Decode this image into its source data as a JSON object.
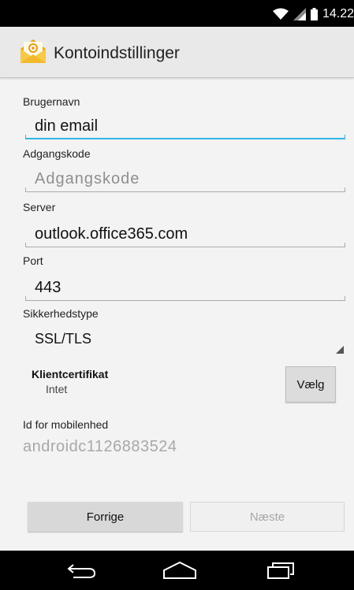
{
  "status_bar": {
    "time": "14.22",
    "icons": [
      "wifi-icon",
      "signal-icon",
      "battery-icon"
    ]
  },
  "app": {
    "title": "Kontoindstillinger",
    "icon": "email-app-icon"
  },
  "form": {
    "username": {
      "label": "Brugernavn",
      "value": "din email"
    },
    "password": {
      "label": "Adgangskode",
      "placeholder": "Adgangskode",
      "value": ""
    },
    "server": {
      "label": "Server",
      "value": "outlook.office365.com"
    },
    "port": {
      "label": "Port",
      "value": "443"
    },
    "security": {
      "label": "Sikkerhedstype",
      "value": "SSL/TLS"
    },
    "client_cert": {
      "label": "Klientcertifikat",
      "value": "Intet",
      "button": "Vælg"
    },
    "device_id": {
      "label": "Id for mobilenhed",
      "value": "androidc1126883524"
    }
  },
  "buttons": {
    "previous": "Forrige",
    "next": "Næste"
  },
  "nav": {
    "icons": [
      "back-icon",
      "home-icon",
      "recent-apps-icon"
    ]
  },
  "colors": {
    "accent": "#33b5e5",
    "status_bar": "#000000",
    "action_bar": "#e9e9e9"
  }
}
